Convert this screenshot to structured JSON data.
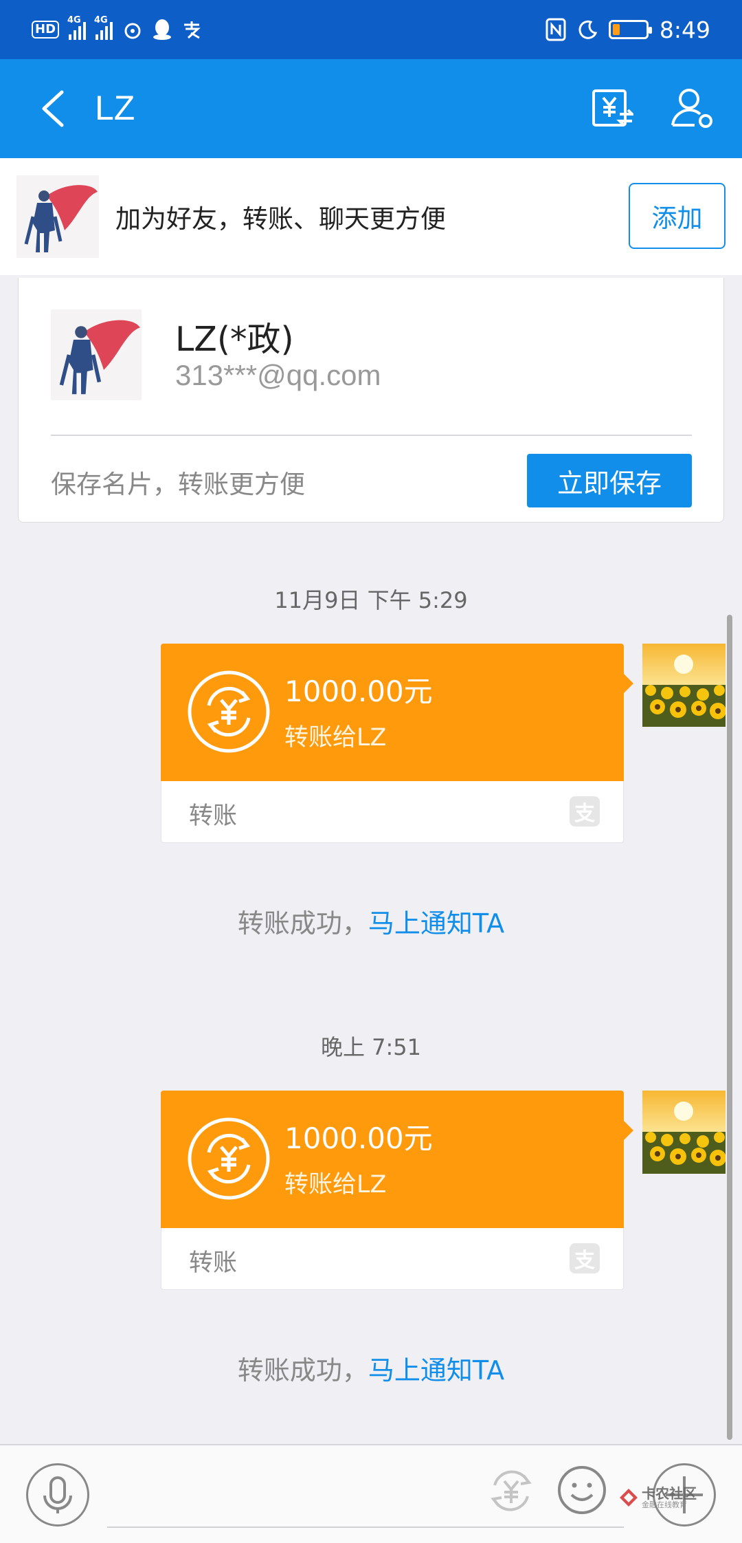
{
  "status_bar": {
    "hd_label": "HD",
    "network_1": "4G",
    "network_2": "4G",
    "time": "8:49",
    "icons": [
      "hd-voice-icon",
      "signal-icon",
      "signal-icon",
      "weibo-icon",
      "qq-icon",
      "alipay-icon",
      "nfc-icon",
      "moon-icon",
      "battery-icon"
    ]
  },
  "nav": {
    "title": "LZ",
    "icons": [
      "back-icon",
      "transfer-icon",
      "profile-settings-icon"
    ]
  },
  "add_friend": {
    "text": "加为好友，转账、聊天更方便",
    "button": "添加"
  },
  "contact_card": {
    "name": "LZ(*政)",
    "email": "313***@qq.com",
    "save_text": "保存名片，转账更方便",
    "save_button": "立即保存"
  },
  "messages": [
    {
      "timestamp": "11月9日 下午 5:29",
      "amount": "1000.00元",
      "recipient": "转账给LZ",
      "type_label": "转账",
      "logo_char": "支",
      "notice_prefix": "转账成功，",
      "notice_link": "马上通知TA"
    },
    {
      "timestamp": "晚上 7:51",
      "amount": "1000.00元",
      "recipient": "转账给LZ",
      "type_label": "转账",
      "logo_char": "支",
      "notice_prefix": "转账成功，",
      "notice_link": "马上通知TA"
    }
  ],
  "input_bar": {
    "icons": [
      "microphone-icon",
      "yuan-transfer-icon",
      "emoji-icon",
      "plus-icon"
    ],
    "watermark_main": "卡农社区",
    "watermark_sub": "金融在线教育"
  },
  "colors": {
    "status_bar": "#0d5ec6",
    "nav_bar": "#108ee9",
    "transfer_orange": "#ff9a0d",
    "link_blue": "#108ee9"
  }
}
